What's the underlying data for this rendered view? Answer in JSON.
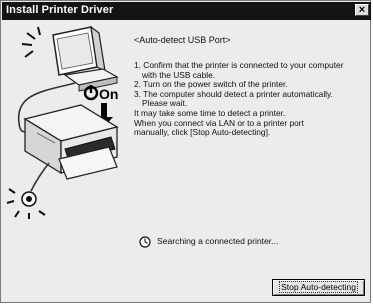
{
  "window": {
    "title": "Install Printer Driver",
    "close_glyph": "×"
  },
  "illustration": {
    "power_label": "On",
    "icons": [
      "computer-icon",
      "printer-icon",
      "usb-cable-icon",
      "power-icon",
      "down-arrow-icon",
      "sun-burst-icon"
    ]
  },
  "content": {
    "heading": "<Auto-detect USB Port>",
    "lines": [
      "1. Confirm that the printer is connected to your computer",
      "with the USB cable.",
      "2. Turn on the power switch of the printer.",
      "3. The computer should detect a printer automatically.",
      "Please wait.",
      "It may take some time to detect a printer.",
      "When you connect via LAN or to a printer port",
      "manually, click [Stop Auto-detecting]."
    ]
  },
  "status": {
    "text": "Searching a connected printer...",
    "icon": "clock-icon"
  },
  "buttons": {
    "stop_label": "Stop Auto-detecting"
  }
}
